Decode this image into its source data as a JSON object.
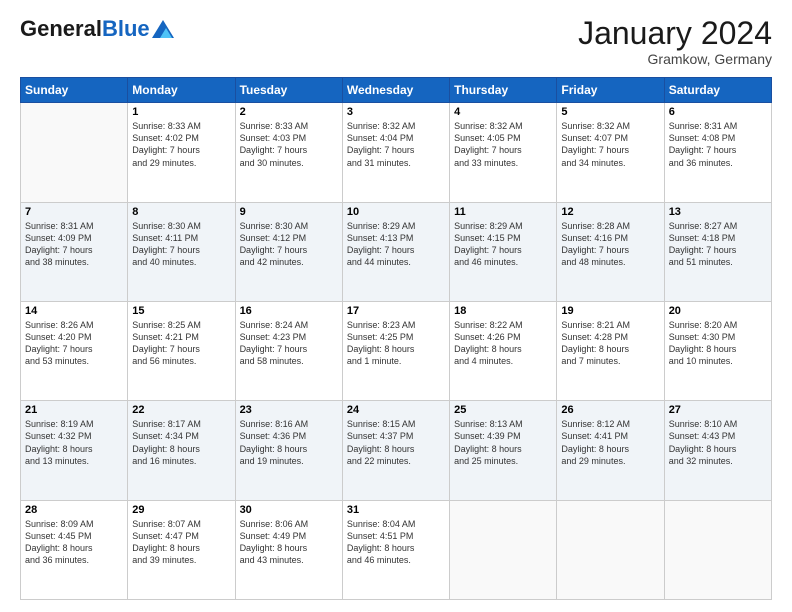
{
  "header": {
    "logo": {
      "general": "General",
      "blue": "Blue"
    },
    "month": "January 2024",
    "location": "Gramkow, Germany"
  },
  "weekdays": [
    "Sunday",
    "Monday",
    "Tuesday",
    "Wednesday",
    "Thursday",
    "Friday",
    "Saturday"
  ],
  "weeks": [
    [
      {
        "day": "",
        "info": ""
      },
      {
        "day": "1",
        "info": "Sunrise: 8:33 AM\nSunset: 4:02 PM\nDaylight: 7 hours\nand 29 minutes."
      },
      {
        "day": "2",
        "info": "Sunrise: 8:33 AM\nSunset: 4:03 PM\nDaylight: 7 hours\nand 30 minutes."
      },
      {
        "day": "3",
        "info": "Sunrise: 8:32 AM\nSunset: 4:04 PM\nDaylight: 7 hours\nand 31 minutes."
      },
      {
        "day": "4",
        "info": "Sunrise: 8:32 AM\nSunset: 4:05 PM\nDaylight: 7 hours\nand 33 minutes."
      },
      {
        "day": "5",
        "info": "Sunrise: 8:32 AM\nSunset: 4:07 PM\nDaylight: 7 hours\nand 34 minutes."
      },
      {
        "day": "6",
        "info": "Sunrise: 8:31 AM\nSunset: 4:08 PM\nDaylight: 7 hours\nand 36 minutes."
      }
    ],
    [
      {
        "day": "7",
        "info": "Sunrise: 8:31 AM\nSunset: 4:09 PM\nDaylight: 7 hours\nand 38 minutes."
      },
      {
        "day": "8",
        "info": "Sunrise: 8:30 AM\nSunset: 4:11 PM\nDaylight: 7 hours\nand 40 minutes."
      },
      {
        "day": "9",
        "info": "Sunrise: 8:30 AM\nSunset: 4:12 PM\nDaylight: 7 hours\nand 42 minutes."
      },
      {
        "day": "10",
        "info": "Sunrise: 8:29 AM\nSunset: 4:13 PM\nDaylight: 7 hours\nand 44 minutes."
      },
      {
        "day": "11",
        "info": "Sunrise: 8:29 AM\nSunset: 4:15 PM\nDaylight: 7 hours\nand 46 minutes."
      },
      {
        "day": "12",
        "info": "Sunrise: 8:28 AM\nSunset: 4:16 PM\nDaylight: 7 hours\nand 48 minutes."
      },
      {
        "day": "13",
        "info": "Sunrise: 8:27 AM\nSunset: 4:18 PM\nDaylight: 7 hours\nand 51 minutes."
      }
    ],
    [
      {
        "day": "14",
        "info": "Sunrise: 8:26 AM\nSunset: 4:20 PM\nDaylight: 7 hours\nand 53 minutes."
      },
      {
        "day": "15",
        "info": "Sunrise: 8:25 AM\nSunset: 4:21 PM\nDaylight: 7 hours\nand 56 minutes."
      },
      {
        "day": "16",
        "info": "Sunrise: 8:24 AM\nSunset: 4:23 PM\nDaylight: 7 hours\nand 58 minutes."
      },
      {
        "day": "17",
        "info": "Sunrise: 8:23 AM\nSunset: 4:25 PM\nDaylight: 8 hours\nand 1 minute."
      },
      {
        "day": "18",
        "info": "Sunrise: 8:22 AM\nSunset: 4:26 PM\nDaylight: 8 hours\nand 4 minutes."
      },
      {
        "day": "19",
        "info": "Sunrise: 8:21 AM\nSunset: 4:28 PM\nDaylight: 8 hours\nand 7 minutes."
      },
      {
        "day": "20",
        "info": "Sunrise: 8:20 AM\nSunset: 4:30 PM\nDaylight: 8 hours\nand 10 minutes."
      }
    ],
    [
      {
        "day": "21",
        "info": "Sunrise: 8:19 AM\nSunset: 4:32 PM\nDaylight: 8 hours\nand 13 minutes."
      },
      {
        "day": "22",
        "info": "Sunrise: 8:17 AM\nSunset: 4:34 PM\nDaylight: 8 hours\nand 16 minutes."
      },
      {
        "day": "23",
        "info": "Sunrise: 8:16 AM\nSunset: 4:36 PM\nDaylight: 8 hours\nand 19 minutes."
      },
      {
        "day": "24",
        "info": "Sunrise: 8:15 AM\nSunset: 4:37 PM\nDaylight: 8 hours\nand 22 minutes."
      },
      {
        "day": "25",
        "info": "Sunrise: 8:13 AM\nSunset: 4:39 PM\nDaylight: 8 hours\nand 25 minutes."
      },
      {
        "day": "26",
        "info": "Sunrise: 8:12 AM\nSunset: 4:41 PM\nDaylight: 8 hours\nand 29 minutes."
      },
      {
        "day": "27",
        "info": "Sunrise: 8:10 AM\nSunset: 4:43 PM\nDaylight: 8 hours\nand 32 minutes."
      }
    ],
    [
      {
        "day": "28",
        "info": "Sunrise: 8:09 AM\nSunset: 4:45 PM\nDaylight: 8 hours\nand 36 minutes."
      },
      {
        "day": "29",
        "info": "Sunrise: 8:07 AM\nSunset: 4:47 PM\nDaylight: 8 hours\nand 39 minutes."
      },
      {
        "day": "30",
        "info": "Sunrise: 8:06 AM\nSunset: 4:49 PM\nDaylight: 8 hours\nand 43 minutes."
      },
      {
        "day": "31",
        "info": "Sunrise: 8:04 AM\nSunset: 4:51 PM\nDaylight: 8 hours\nand 46 minutes."
      },
      {
        "day": "",
        "info": ""
      },
      {
        "day": "",
        "info": ""
      },
      {
        "day": "",
        "info": ""
      }
    ]
  ]
}
